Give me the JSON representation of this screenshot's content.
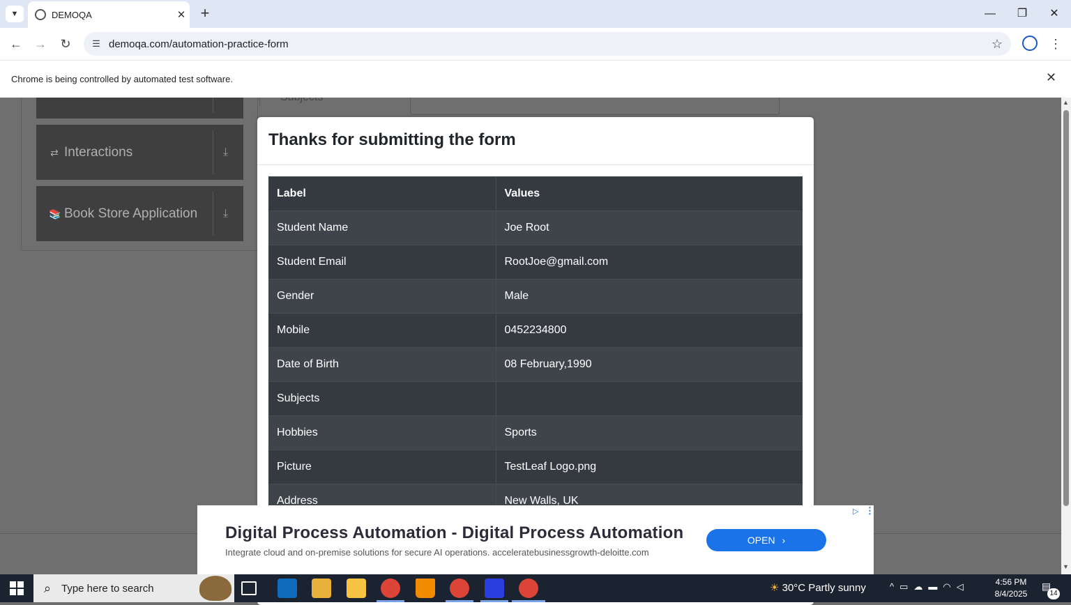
{
  "browser": {
    "tab_title": "DEMOQA",
    "url": "demoqa.com/automation-practice-form",
    "infobar_message": "Chrome is being controlled by automated test software."
  },
  "background": {
    "sidebar_groups": [
      "Interactions",
      "Book Store Application"
    ],
    "subjects_label": "Subjects"
  },
  "modal": {
    "title": "Thanks for submitting the form",
    "header_label": "Label",
    "header_values": "Values",
    "rows": [
      {
        "label": "Student Name",
        "value": "Joe Root"
      },
      {
        "label": "Student Email",
        "value": "RootJoe@gmail.com"
      },
      {
        "label": "Gender",
        "value": "Male"
      },
      {
        "label": "Mobile",
        "value": "0452234800"
      },
      {
        "label": "Date of Birth",
        "value": "08 February,1990"
      },
      {
        "label": "Subjects",
        "value": ""
      },
      {
        "label": "Hobbies",
        "value": "Sports"
      },
      {
        "label": "Picture",
        "value": "TestLeaf Logo.png"
      },
      {
        "label": "Address",
        "value": "New Walls, UK"
      }
    ]
  },
  "ad": {
    "title": "Digital Process Automation - Digital Process Automation",
    "subtitle": "Integrate cloud and on-premise solutions for secure AI operations. acceleratebusinessgrowth-deloitte.com",
    "button": "OPEN"
  },
  "taskbar": {
    "search_placeholder": "Type here to search",
    "weather": "30°C  Partly sunny",
    "time": "4:56 PM",
    "date": "8/4/2025",
    "notification_count": "14"
  },
  "colors": {
    "accent": "#1a73e8",
    "table_dark": "#343a40",
    "table_stripe": "#3e444a"
  }
}
